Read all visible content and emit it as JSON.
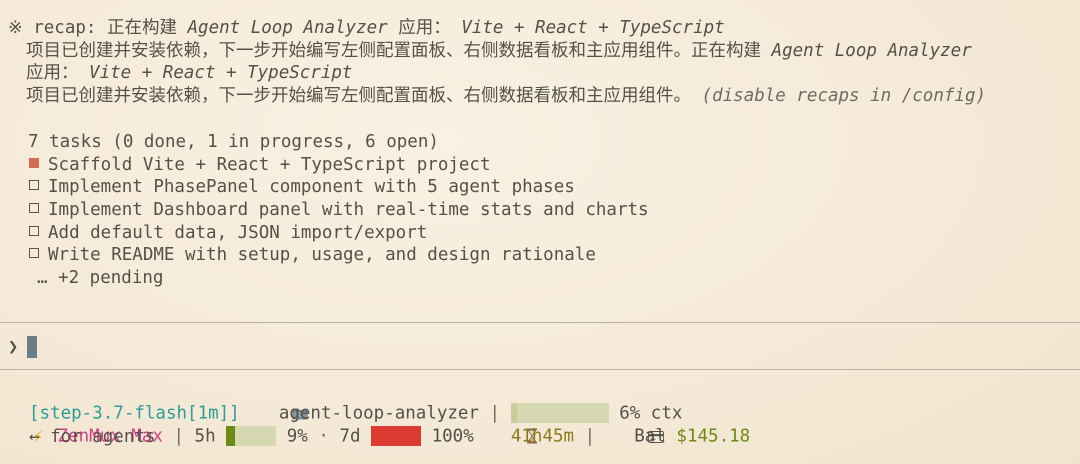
{
  "recap": {
    "marker": "※",
    "prefix": "recap: 正在构建 ",
    "app_name": "Agent Loop Analyzer",
    "app_suffix": " 应用： ",
    "stack": "Vite + React + TypeScript",
    "body_1": "项目已创建并安装依赖，下一步开始编写左侧配置面板、右侧数据看板和主应用组件。正在构建 ",
    "app_name_2": "Agent Loop Analyzer",
    "line3_prefix": "应用： ",
    "stack_2": "Vite + React + TypeScript",
    "body_2": "项目已创建并安装依赖，下一步开始编写左侧配置面板、右侧数据看板和主应用组件。 ",
    "hint": "(disable recaps in /config)"
  },
  "tasks": {
    "summary": "7 tasks (0 done, 1 in progress, 6 open)",
    "items": [
      {
        "label": "Scaffold Vite + React + TypeScript project",
        "status": "in_progress"
      },
      {
        "label": "Implement PhasePanel component with 5 agent phases",
        "status": "open"
      },
      {
        "label": "Implement Dashboard panel with real-time stats and charts",
        "status": "open"
      },
      {
        "label": "Add default data, JSON import/export",
        "status": "open"
      },
      {
        "label": "Write README with setup, usage, and design rationale",
        "status": "open"
      }
    ],
    "pending": "… +2 pending"
  },
  "prompt": {
    "caret": "❯",
    "value": ""
  },
  "status": {
    "model": "[step-3.7-flash[1m]]",
    "folder_icon": "folder-icon",
    "project": "agent-loop-analyzer",
    "sep": "|",
    "ctx_percent": 6,
    "ctx_label": "6% ctx",
    "bolt_icon": "lightning-icon",
    "plan": "ZenMux Max",
    "window_5h": "5h",
    "usage_5h_percent": 9,
    "usage_5h_label": "9%",
    "dot": "·",
    "window_7d": "7d",
    "usage_7d_percent": 100,
    "usage_7d_label": "100%",
    "hourglass_icon": "hourglass-icon",
    "reset": "41h45m",
    "card_icon": "credit-card-icon",
    "balance_label": "Bal",
    "balance_value": "$145.18"
  },
  "footer": {
    "hint": "← for agents"
  },
  "colors": {
    "background": "#f6ecdc",
    "accent_task": "#d46a52",
    "model": "#2a9d98",
    "plan": "#d43d8a",
    "reset": "#8a7a1a",
    "balance": "#6e8a16",
    "usage_full": "#dc3b32",
    "bar_track": "#d6d8b1"
  }
}
